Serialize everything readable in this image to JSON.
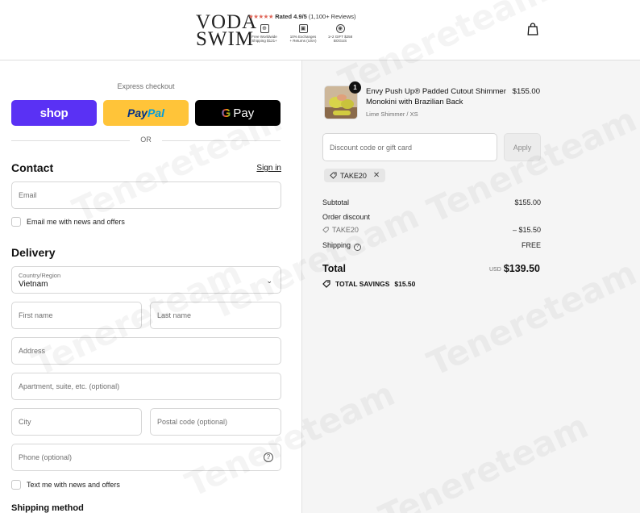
{
  "header": {
    "logo_line1": "VODA",
    "logo_line2": "SWIM",
    "rating_stars": "★★★★★",
    "rating_text": "Rated 4.9/5",
    "rating_reviews": "(1,100+ Reviews)",
    "perks": [
      {
        "icon": "globe-icon",
        "line1": "Free Worldwide",
        "line2": "Shipping $121+"
      },
      {
        "icon": "box-icon",
        "line1": "10% Exchanges",
        "line2": "+ Returns (USA)"
      },
      {
        "icon": "tag-icon",
        "line1": "1+2 GIFT $258",
        "line2": "BOGUS"
      }
    ],
    "cart_icon": "shopping-bag-icon"
  },
  "express": {
    "label": "Express checkout",
    "shop_label": "shop",
    "paypal_pay": "Pay",
    "paypal_pal": "Pal",
    "gpay_g": "G",
    "gpay_label": "Pay",
    "or_label": "OR"
  },
  "contact": {
    "title": "Contact",
    "signin": "Sign in",
    "email_placeholder": "Email",
    "newsletter_label": "Email me with news and offers"
  },
  "delivery": {
    "title": "Delivery",
    "country_label": "Country/Region",
    "country_value": "Vietnam",
    "first_name": "First name",
    "last_name": "Last name",
    "address": "Address",
    "apartment": "Apartment, suite, etc. (optional)",
    "city": "City",
    "postal": "Postal code (optional)",
    "phone": "Phone (optional)",
    "sms_label": "Text me with news and offers"
  },
  "shipping_method": {
    "title": "Shipping method"
  },
  "order": {
    "item": {
      "quantity": "1",
      "name": "Envy Push Up® Padded Cutout Shimmer Monokini with Brazilian Back",
      "variant": "Lime Shimmer / XS",
      "price": "$155.00"
    },
    "discount_placeholder": "Discount code or gift card",
    "apply_label": "Apply",
    "applied_code": "TAKE20",
    "subtotal_label": "Subtotal",
    "subtotal_value": "$155.00",
    "order_discount_label": "Order discount",
    "discount_code": "TAKE20",
    "discount_value": "– $15.50",
    "shipping_label": "Shipping",
    "shipping_value": "FREE",
    "total_label": "Total",
    "currency": "USD",
    "total_value": "$139.50",
    "savings_label": "TOTAL SAVINGS",
    "savings_value": "$15.50"
  },
  "watermark": "Tenereteam",
  "colors": {
    "shop_pay": "#5a31f4",
    "paypal": "#ffc439",
    "gpay": "#000000",
    "summary_bg": "#f5f5f5"
  }
}
